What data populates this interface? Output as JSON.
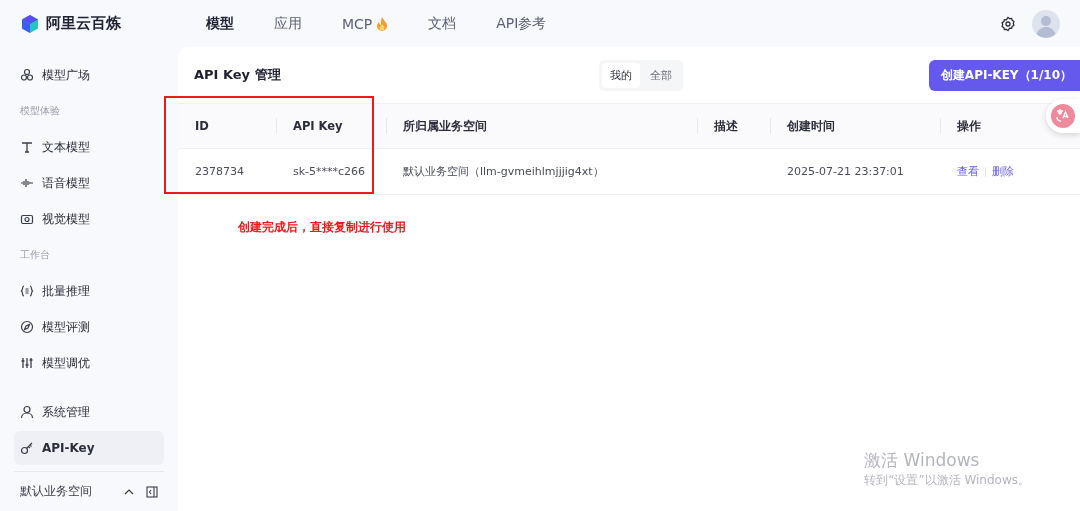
{
  "brand": {
    "name": "阿里云百炼"
  },
  "nav": [
    {
      "label": "模型",
      "selected": true
    },
    {
      "label": "应用",
      "selected": false
    },
    {
      "label": "MCP",
      "selected": false
    },
    {
      "label": "文档",
      "selected": false
    },
    {
      "label": "API参考",
      "selected": false
    }
  ],
  "sidebar": {
    "items": [
      {
        "kind": "item",
        "label": "模型广场",
        "selected": false
      },
      {
        "kind": "section",
        "label": "模型体验"
      },
      {
        "kind": "item",
        "label": "文本模型",
        "selected": false
      },
      {
        "kind": "item",
        "label": "语音模型",
        "selected": false
      },
      {
        "kind": "item",
        "label": "视觉模型",
        "selected": false
      },
      {
        "kind": "section",
        "label": "工作台"
      },
      {
        "kind": "item",
        "label": "批量推理",
        "selected": false
      },
      {
        "kind": "item",
        "label": "模型评测",
        "selected": false
      },
      {
        "kind": "item",
        "label": "模型调优",
        "selected": false
      }
    ],
    "bottom_items": [
      {
        "label": "系统管理",
        "selected": false
      },
      {
        "label": "API-Key",
        "selected": true
      }
    ],
    "workspace": "默认业务空间"
  },
  "page": {
    "title": "API Key 管理",
    "filter_tabs": [
      {
        "label": "我的",
        "selected": true
      },
      {
        "label": "全部",
        "selected": false
      }
    ],
    "create_button": "创建API-KEY（1/10）",
    "table": {
      "columns": [
        "ID",
        "API Key",
        "所归属业务空间",
        "描述",
        "创建时间",
        "操作"
      ],
      "rows": [
        {
          "id": "2378734",
          "api_key": "sk-5****c266",
          "workspace": "默认业务空间（llm-gvmeihlmjjjig4xt）",
          "created": "2025-07-21 23:37:01",
          "actions": [
            "查看",
            "删除"
          ]
        }
      ]
    },
    "annotation": "创建完成后，直接复制进行使用"
  },
  "os_notice": {
    "title": "激活 Windows",
    "text": "转到“设置”以激活 Windows。"
  }
}
